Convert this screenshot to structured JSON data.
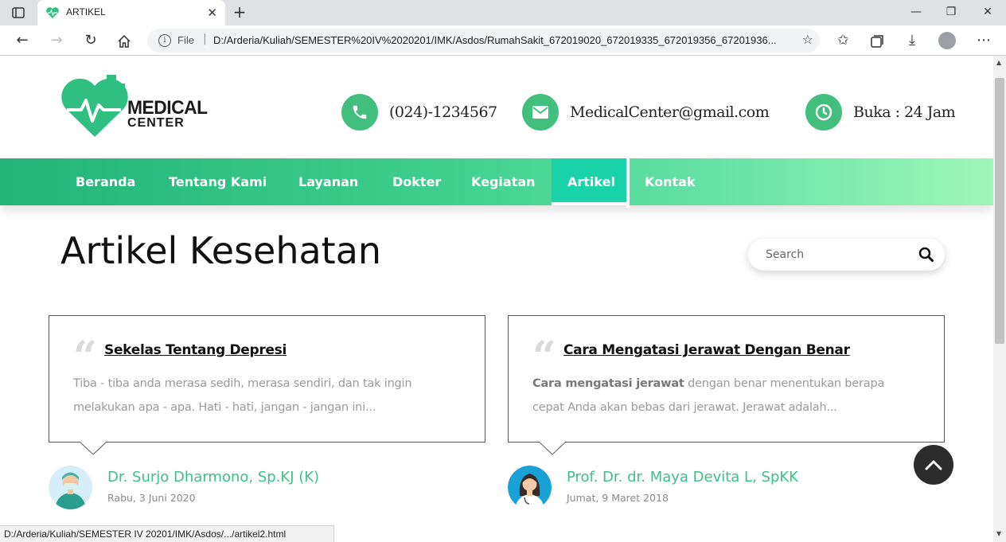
{
  "browser": {
    "tab_title": "ARTIKEL",
    "url_scheme_label": "File",
    "url": "D:/Arderia/Kuliah/SEMESTER%20IV%2020201/IMK/Asdos/RumahSakit_672019020_672019335_672019356_67201936...",
    "status_url": "D:/Arderia/Kuliah/SEMESTER IV 20201/IMK/Asdos/.../artikel2.html"
  },
  "header": {
    "logo_line1": "MEDICAL",
    "logo_line2": "CENTER",
    "phone": "(024)-1234567",
    "email": "MedicalCenter@gmail.com",
    "hours": "Buka : 24 Jam"
  },
  "nav": {
    "items": [
      "Beranda",
      "Tentang Kami",
      "Layanan",
      "Dokter",
      "Kegiatan",
      "Artikel",
      "Kontak"
    ],
    "active": "Artikel"
  },
  "page": {
    "title": "Artikel Kesehatan",
    "search_placeholder": "Search"
  },
  "articles": [
    {
      "title": "Sekelas Tentang Depresi",
      "excerpt_line1": "Tiba - tiba anda merasa sedih, merasa sendiri, dan tak ingin",
      "excerpt_line2": "melakukan apa - apa. Hati - hati, jangan - jangan ini...",
      "author": "Dr. Surjo Dharmono, Sp.KJ (K)",
      "date": "Rabu, 3 Juni 2020"
    },
    {
      "title": "Cara Mengatasi Jerawat Dengan Benar",
      "excerpt_bold": "Cara mengatasi jerawat",
      "excerpt_line1_rest": " dengan benar menentukan berapa",
      "excerpt_line2": "cepat Anda akan bebas dari jerawat. Jerawat adalah...",
      "author": "Prof. Dr. dr. Maya Devita L, SpKK",
      "date": "Jumat, 9 Maret 2018"
    }
  ],
  "colors": {
    "brand_green": "#42be7d",
    "nav_active": "#19d2a8",
    "author_name": "#3dbf8a"
  }
}
